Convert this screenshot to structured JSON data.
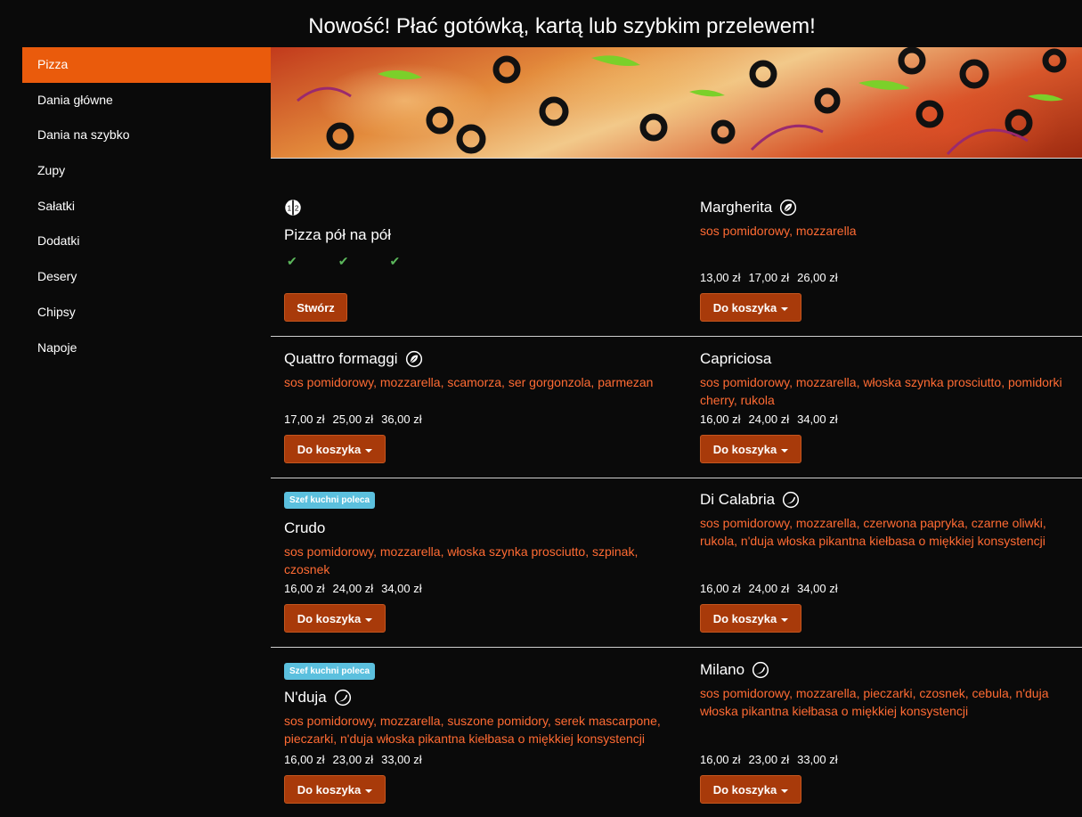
{
  "announcement": "Nowość! Płać gotówką, kartą lub szybkim przelewem!",
  "sidebar": {
    "items": [
      {
        "label": "Pizza",
        "active": true
      },
      {
        "label": "Dania główne"
      },
      {
        "label": "Dania na szybko"
      },
      {
        "label": "Zupy"
      },
      {
        "label": "Sałatki"
      },
      {
        "label": "Dodatki"
      },
      {
        "label": "Desery"
      },
      {
        "label": "Chipsy"
      },
      {
        "label": "Napoje"
      }
    ]
  },
  "colors": {
    "accent": "#ea5b0c",
    "button": "#a83a0a",
    "ingredients": "#ff6b33",
    "badge": "#5bc0de",
    "check": "#5cb85c"
  },
  "half_half": {
    "title": "Pizza pół na pół",
    "icon": "half-half-icon",
    "button": "Stwórz"
  },
  "add_label": "Do koszyka",
  "badge_label": "Szef kuchni poleca",
  "products": [
    {
      "name": "Margherita",
      "icon": "leaf-icon",
      "desc": "sos pomidorowy, mozzarella",
      "prices": [
        "13,00 zł",
        "17,00 zł",
        "26,00 zł"
      ]
    },
    {
      "name": "Quattro formaggi",
      "icon": "leaf-icon",
      "desc": "sos pomidorowy, mozzarella, scamorza, ser gorgonzola, parmezan",
      "prices": [
        "17,00 zł",
        "25,00 zł",
        "36,00 zł"
      ]
    },
    {
      "name": "Capriciosa",
      "desc": "sos pomidorowy, mozzarella, włoska szynka prosciutto, pomidorki cherry, rukola",
      "prices": [
        "16,00 zł",
        "24,00 zł",
        "34,00 zł"
      ]
    },
    {
      "name": "Crudo",
      "badge": true,
      "desc": "sos pomidorowy, mozzarella, włoska szynka prosciutto, szpinak, czosnek",
      "prices": [
        "16,00 zł",
        "24,00 zł",
        "34,00 zł"
      ]
    },
    {
      "name": "Di Calabria",
      "icon": "chili-icon",
      "desc": "sos pomidorowy, mozzarella, czerwona papryka, czarne oliwki, rukola, n'duja włoska pikantna kiełbasa o miękkiej konsystencji",
      "prices": [
        "16,00 zł",
        "24,00 zł",
        "34,00 zł"
      ]
    },
    {
      "name": "N'duja",
      "icon": "chili-icon",
      "badge": true,
      "desc": "sos pomidorowy, mozzarella, suszone pomidory, serek mascarpone, pieczarki, n'duja włoska pikantna kiełbasa o miękkiej konsystencji",
      "prices": [
        "16,00 zł",
        "23,00 zł",
        "33,00 zł"
      ]
    },
    {
      "name": "Milano",
      "icon": "chili-icon",
      "desc": "sos pomidorowy, mozzarella, pieczarki, czosnek, cebula, n'duja włoska pikantna kiełbasa o miękkiej konsystencji",
      "prices": [
        "16,00 zł",
        "23,00 zł",
        "33,00 zł"
      ]
    }
  ]
}
